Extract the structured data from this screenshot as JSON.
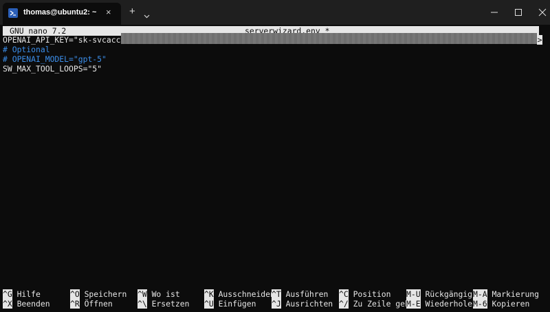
{
  "window": {
    "tab_title": "thomas@ubuntu2: ~",
    "tab_icon": "powershell-icon",
    "close_tab_glyph": "×",
    "new_tab_glyph": "+",
    "dropdown_glyph": "⌄"
  },
  "nano": {
    "version": "GNU nano 7.2",
    "filename": "serverwizard.env *",
    "lines": [
      {
        "text": "OPENAI_API_KEY=\"sk-svcacct-",
        "type": "normal"
      },
      {
        "text": "# Optional",
        "type": "comment"
      },
      {
        "text": "# OPENAI_MODEL=\"gpt-5\"",
        "type": "comment"
      },
      {
        "text": "SW_MAX_TOOL_LOOPS=\"5\"",
        "type": "normal"
      }
    ],
    "truncation_marker": ">",
    "shortcuts_row1": [
      {
        "key": "^G",
        "label": "Hilfe"
      },
      {
        "key": "^O",
        "label": "Speichern"
      },
      {
        "key": "^W",
        "label": "Wo ist"
      },
      {
        "key": "^K",
        "label": "Ausschneiden"
      },
      {
        "key": "^T",
        "label": "Ausführen"
      },
      {
        "key": "^C",
        "label": "Position"
      },
      {
        "key": "M-U",
        "label": "Rückgängig"
      },
      {
        "key": "M-A",
        "label": "Markierung"
      }
    ],
    "shortcuts_row2": [
      {
        "key": "^X",
        "label": "Beenden"
      },
      {
        "key": "^R",
        "label": "Öffnen"
      },
      {
        "key": "^\\",
        "label": "Ersetzen"
      },
      {
        "key": "^U",
        "label": "Einfügen"
      },
      {
        "key": "^J",
        "label": "Ausrichten"
      },
      {
        "key": "^/",
        "label": "Zu Zeile geh"
      },
      {
        "key": "M-E",
        "label": "Wiederholen"
      },
      {
        "key": "M-6",
        "label": "Kopieren"
      }
    ]
  },
  "colors": {
    "background": "#0c0c0c",
    "foreground": "#e6e6e6",
    "comment": "#3b8eea",
    "titlebar": "#1f1f1f"
  }
}
